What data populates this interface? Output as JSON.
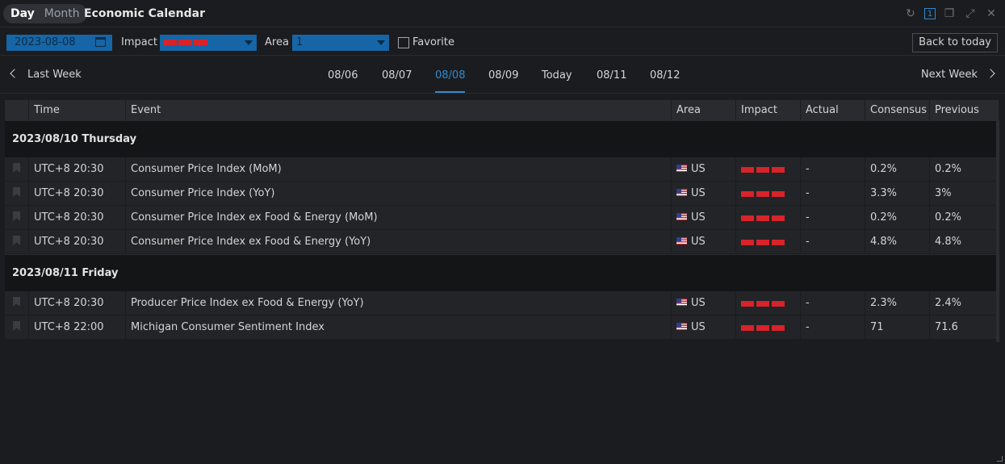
{
  "titlebar": {
    "tab_day": "Day",
    "tab_month": "Month",
    "title": "Economic Calendar",
    "window_number": "1"
  },
  "filters": {
    "date": "2023-08-08",
    "impact_label": "Impact",
    "area_label": "Area",
    "area_value": "1",
    "favorite_label": "Favorite",
    "back_to_today": "Back to today"
  },
  "weeknav": {
    "last_week": "Last Week",
    "next_week": "Next Week",
    "days": [
      "08/06",
      "08/07",
      "08/08",
      "08/09",
      "Today",
      "08/11",
      "08/12"
    ],
    "active_day": "08/08"
  },
  "table": {
    "headers": [
      "",
      "Time",
      "Event",
      "Area",
      "Impact",
      "Actual",
      "Consensus",
      "Previous"
    ],
    "groups": [
      {
        "date": "2023/08/10 Thursday",
        "rows": [
          {
            "time": "UTC+8 20:30",
            "event": "Consumer Price Index (MoM)",
            "area": "US",
            "actual": "-",
            "consensus": "0.2%",
            "previous": "0.2%"
          },
          {
            "time": "UTC+8 20:30",
            "event": "Consumer Price Index (YoY)",
            "area": "US",
            "actual": "-",
            "consensus": "3.3%",
            "previous": "3%"
          },
          {
            "time": "UTC+8 20:30",
            "event": "Consumer Price Index ex Food & Energy (MoM)",
            "area": "US",
            "actual": "-",
            "consensus": "0.2%",
            "previous": "0.2%"
          },
          {
            "time": "UTC+8 20:30",
            "event": "Consumer Price Index ex Food & Energy (YoY)",
            "area": "US",
            "actual": "-",
            "consensus": "4.8%",
            "previous": "4.8%"
          }
        ]
      },
      {
        "date": "2023/08/11 Friday",
        "rows": [
          {
            "time": "UTC+8 20:30",
            "event": "Producer Price Index ex Food & Energy (YoY)",
            "area": "US",
            "actual": "-",
            "consensus": "2.3%",
            "previous": "2.4%"
          },
          {
            "time": "UTC+8 22:00",
            "event": "Michigan Consumer Sentiment Index",
            "area": "US",
            "actual": "-",
            "consensus": "71",
            "previous": "71.6"
          }
        ]
      }
    ]
  },
  "colors": {
    "accent": "#2f8ad0",
    "impact_high": "#d8232a",
    "select_bg": "#1665a6"
  }
}
